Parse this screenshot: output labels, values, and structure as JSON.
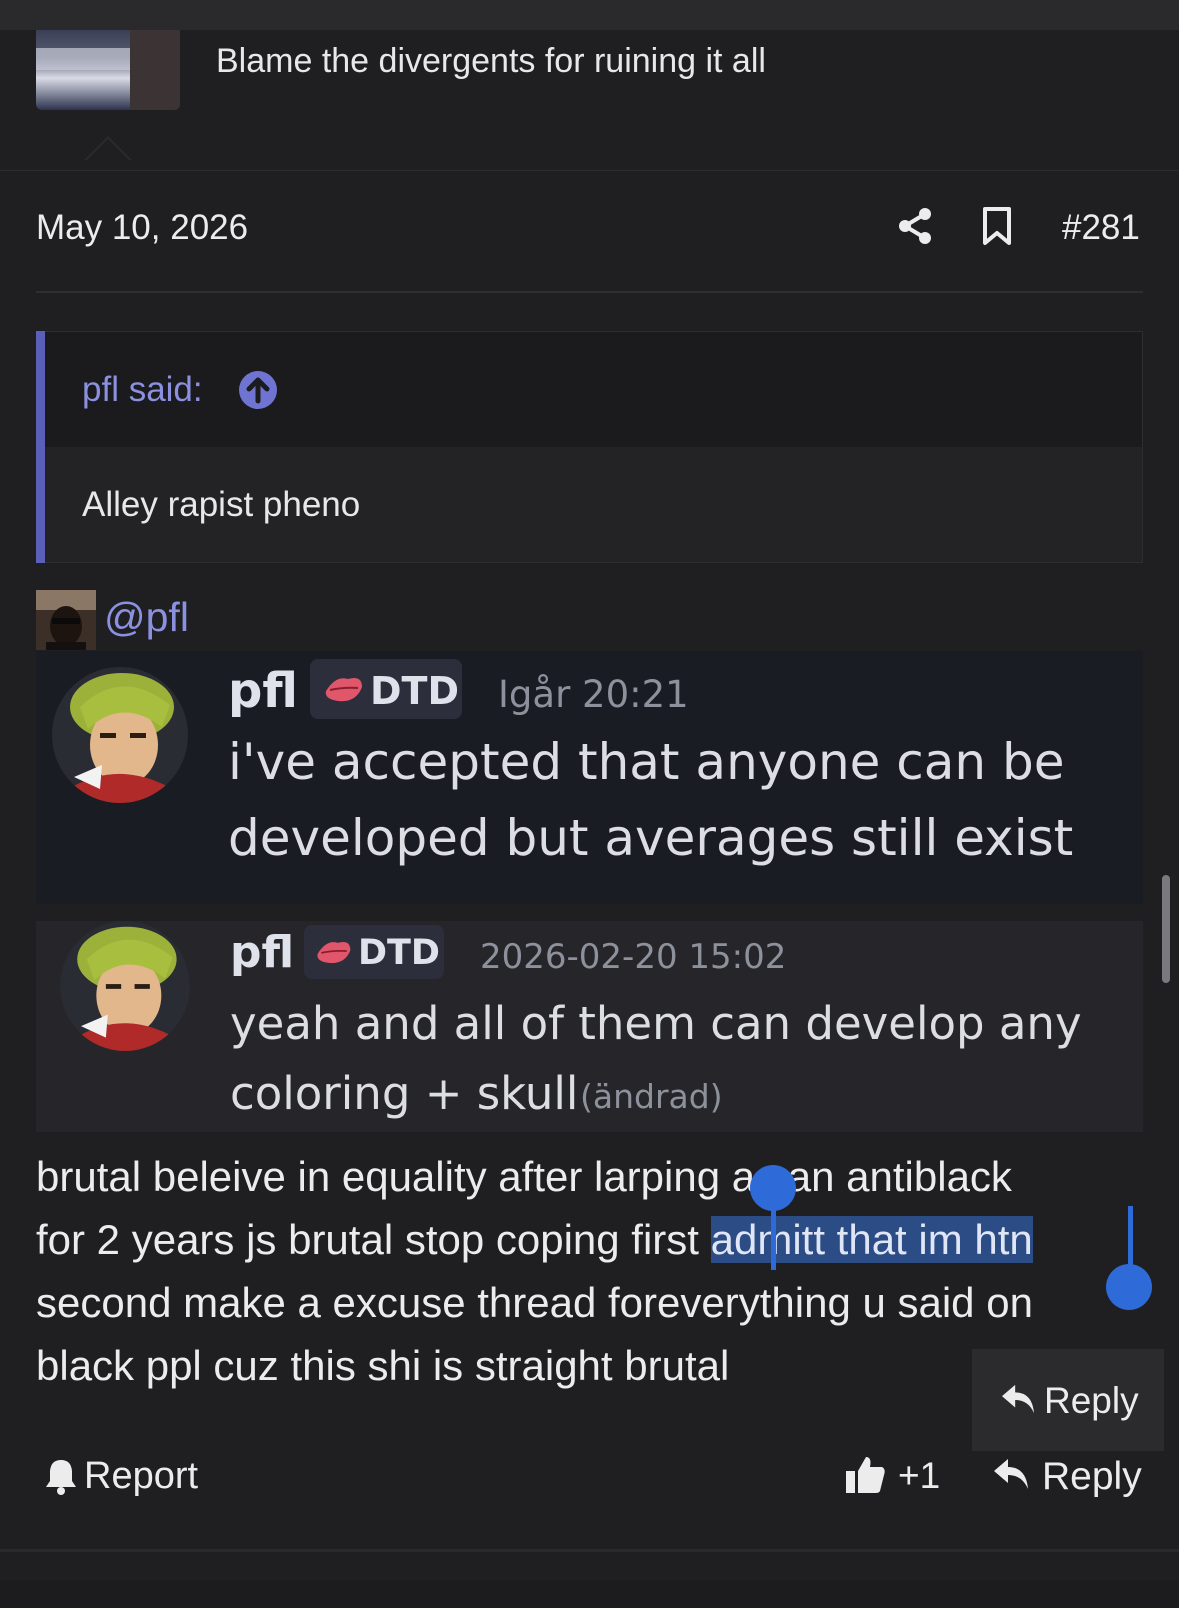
{
  "previous_post": {
    "text": "Blame the divergents for ruining it all"
  },
  "post": {
    "date": "May 10, 2026",
    "number": "#281",
    "quote": {
      "author": "pfl said:",
      "text": "Alley rapist pheno"
    },
    "mention": "@pfl",
    "screenshot_messages": [
      {
        "name": "pfl",
        "tag": "DTD",
        "time": "Igår 20:21",
        "lines": [
          "i've accepted that anyone can be",
          "developed but averages still exist"
        ],
        "edited": ""
      },
      {
        "name": "pfl",
        "tag": "DTD",
        "time": "2026-02-20 15:02",
        "lines": [
          "yeah and all of them can develop any",
          "coloring + skull"
        ],
        "edited": "(ändrad)"
      }
    ],
    "body": {
      "line1": "brutal beleive in equality after larping as an antiblack",
      "line2_before": "for 2 years js brutal stop coping first ",
      "line2_selected": "admitt that im htn",
      "line3": "second make a excuse thread foreverything u said on",
      "line4": "black ppl cuz this shi is straight brutal"
    },
    "context_menu": {
      "reply_label": "Reply"
    },
    "actions": {
      "report_label": "Report",
      "like_count": "+1",
      "reply_label": "Reply"
    }
  },
  "colors": {
    "background": "#1f1f21",
    "quote_accent": "#5a60b8",
    "link": "#8b90df",
    "selection": "#2f6ad9"
  }
}
